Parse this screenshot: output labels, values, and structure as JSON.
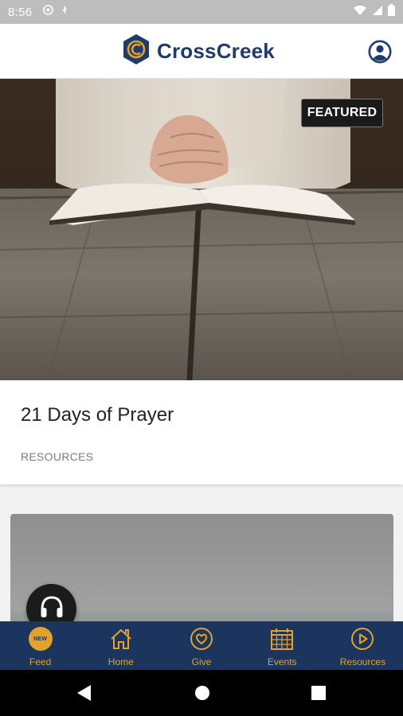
{
  "status_bar": {
    "time": "8:56",
    "left_icons": [
      "vpn-key-icon",
      "battery-saver-icon"
    ],
    "right_icons": [
      "wifi-icon",
      "signal-icon",
      "battery-icon"
    ]
  },
  "header": {
    "brand": "CrossCreek",
    "logo_icon": "crosscreek-hexagon-logo-icon",
    "profile_icon": "user-profile-icon"
  },
  "featured": {
    "badge": "FEATURED",
    "image": "praying-hands-on-open-bible",
    "title": "21 Days of Prayer",
    "category": "RESOURCES"
  },
  "next_card": {
    "image": "foggy-sky-landscape"
  },
  "audio_button": {
    "icon": "headphones-icon"
  },
  "bottom_nav": {
    "items": [
      {
        "label": "Feed",
        "icon": "new-badge-icon",
        "badge": "NEW"
      },
      {
        "label": "Home",
        "icon": "home-icon"
      },
      {
        "label": "Give",
        "icon": "heart-circle-icon"
      },
      {
        "label": "Events",
        "icon": "calendar-icon"
      },
      {
        "label": "Resources",
        "icon": "play-circle-icon"
      }
    ]
  },
  "colors": {
    "brand_navy": "#1c355e",
    "accent_gold": "#e3a32a",
    "status_bar": "#bdbdbd"
  }
}
